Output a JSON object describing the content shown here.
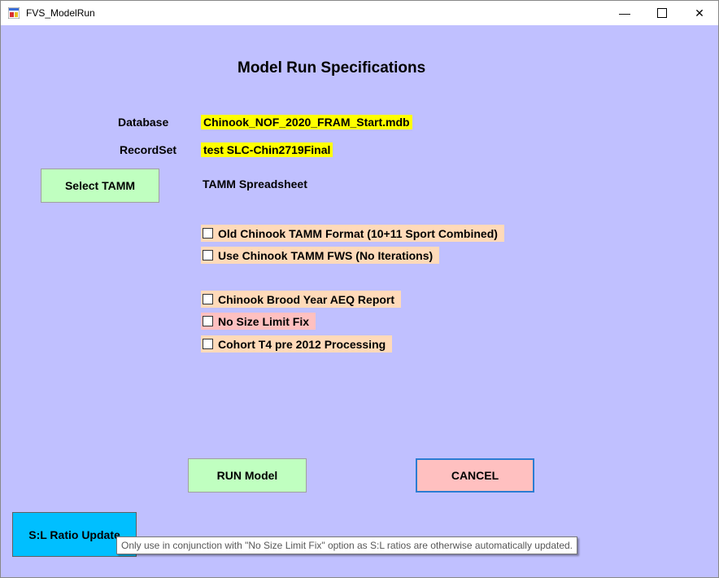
{
  "window": {
    "title": "FVS_ModelRun"
  },
  "form": {
    "heading": "Model Run Specifications",
    "database_label": "Database",
    "database_value": "Chinook_NOF_2020_FRAM_Start.mdb",
    "recordset_label": "RecordSet",
    "recordset_value": "test SLC-Chin2719Final",
    "select_tamm": "Select TAMM",
    "tamm_label": "TAMM Spreadsheet"
  },
  "options": [
    {
      "label": "Old Chinook TAMM Format (10+11 Sport Combined)",
      "checked": false
    },
    {
      "label": "Use Chinook TAMM FWS (No Iterations)",
      "checked": false
    },
    {
      "label": "Chinook Brood Year AEQ Report",
      "checked": false
    },
    {
      "label": "No Size Limit Fix",
      "checked": false
    },
    {
      "label": "Cohort T4 pre 2012 Processing",
      "checked": false
    }
  ],
  "buttons": {
    "run": "RUN Model",
    "cancel": "CANCEL",
    "sl_ratio": "S:L Ratio Update"
  },
  "tooltip": "Only use in conjunction with \"No Size Limit Fix\" option as S:L ratios are otherwise automatically updated.",
  "colors": {
    "background": "#c0c0ff",
    "highlight": "#ffff00",
    "option_bg": "#ffdab9",
    "option_warning_bg": "#ffc0c0",
    "run_button": "#c0ffc0",
    "cancel_button": "#ffc0c0",
    "sl_ratio_button": "#00bfff"
  }
}
